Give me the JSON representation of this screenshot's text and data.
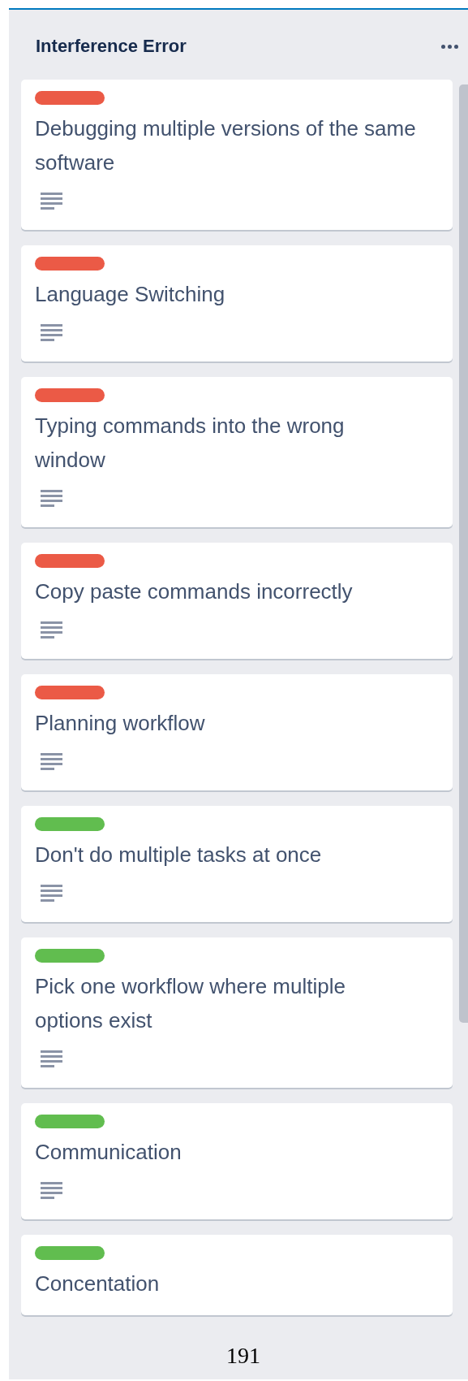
{
  "list": {
    "title": "Interference Error",
    "cards": [
      {
        "title": "Debugging multiple versions of the same software",
        "color": "#eb5a46",
        "has_description": true
      },
      {
        "title": "Language Switching",
        "color": "#eb5a46",
        "has_description": true
      },
      {
        "title": "Typing commands into the wrong window",
        "color": "#eb5a46",
        "has_description": true
      },
      {
        "title": "Copy paste commands incorrectly",
        "color": "#eb5a46",
        "has_description": true
      },
      {
        "title": "Planning workflow",
        "color": "#eb5a46",
        "has_description": true
      },
      {
        "title": "Don't do multiple tasks at once",
        "color": "#61bd4f",
        "has_description": true
      },
      {
        "title": "Pick one workflow where multiple options exist",
        "color": "#61bd4f",
        "has_description": true
      },
      {
        "title": "Communication",
        "color": "#61bd4f",
        "has_description": true
      },
      {
        "title": "Concentation",
        "color": "#61bd4f",
        "has_description": false
      }
    ]
  },
  "page_number": "191"
}
